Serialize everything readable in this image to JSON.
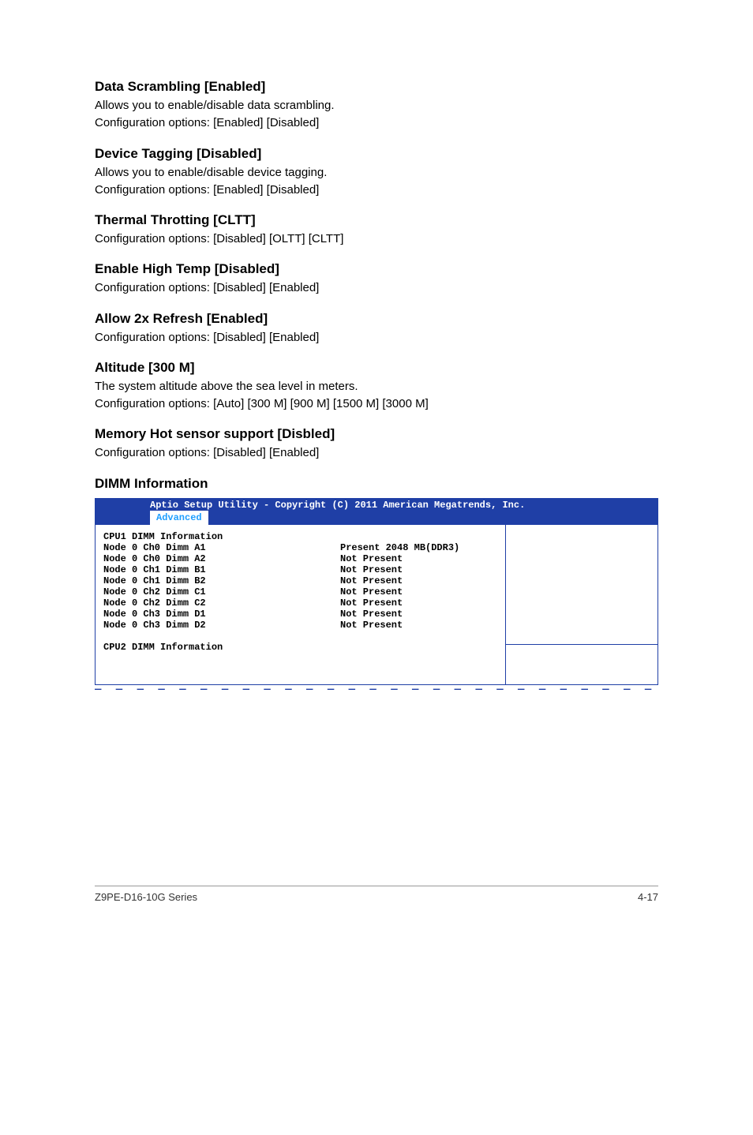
{
  "sections": [
    {
      "heading": "Data Scrambling [Enabled]",
      "paras": [
        "Allows you to enable/disable data scrambling.",
        "Configuration options: [Enabled] [Disabled]"
      ]
    },
    {
      "heading": "Device Tagging [Disabled]",
      "paras": [
        "Allows you to enable/disable device tagging.",
        "Configuration options: [Enabled] [Disabled]"
      ]
    },
    {
      "heading": "Thermal Throtting [CLTT]",
      "paras": [
        "Configuration options: [Disabled] [OLTT] [CLTT]"
      ]
    },
    {
      "heading": "Enable High Temp [Disabled]",
      "paras": [
        "Configuration options: [Disabled] [Enabled]"
      ]
    },
    {
      "heading": "Allow 2x Refresh [Enabled]",
      "paras": [
        "Configuration options: [Disabled] [Enabled]"
      ]
    },
    {
      "heading": "Altitude [300 M]",
      "paras": [
        "The system altitude above the sea level in meters.",
        "Configuration options: [Auto] [300 M] [900 M] [1500 M] [3000 M]"
      ]
    },
    {
      "heading": "Memory Hot sensor support [Disbled]",
      "paras": [
        "Configuration options: [Disabled] [Enabled]"
      ]
    },
    {
      "heading": "DIMM Information",
      "paras": []
    }
  ],
  "bios": {
    "title_line": "Aptio Setup Utility - Copyright (C) 2011 American Megatrends, Inc.",
    "active_tab": "Advanced",
    "cpu1_heading": "CPU1 DIMM Information",
    "dimm_rows": [
      {
        "label": "Node 0 Ch0 Dimm A1",
        "value": "Present 2048 MB(DDR3)"
      },
      {
        "label": "Node 0 Ch0 Dimm A2",
        "value": "Not Present"
      },
      {
        "label": "Node 0 Ch1 Dimm B1",
        "value": "Not Present"
      },
      {
        "label": "Node 0 Ch1 Dimm B2",
        "value": "Not Present"
      },
      {
        "label": "Node 0 Ch2 Dimm C1",
        "value": "Not Present"
      },
      {
        "label": "Node 0 Ch2 Dimm C2",
        "value": "Not Present"
      },
      {
        "label": "Node 0 Ch3 Dimm D1",
        "value": "Not Present"
      },
      {
        "label": "Node 0 Ch3 Dimm D2",
        "value": "Not Present"
      }
    ],
    "cpu2_heading": "CPU2 DIMM Information"
  },
  "footer": {
    "left": "Z9PE-D16-10G Series",
    "right": "4-17"
  }
}
